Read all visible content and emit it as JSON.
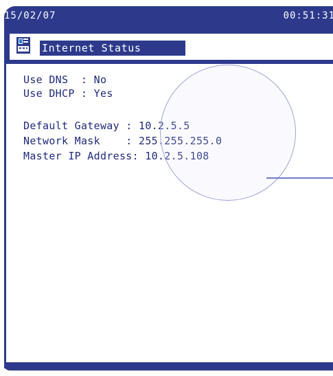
{
  "status_bar": {
    "date": "15/02/07",
    "time": "00:51:31"
  },
  "header": {
    "icon": "network-device-icon",
    "title": "Internet Status"
  },
  "settings": [
    {
      "label": "Use DNS  ",
      "separator": ":",
      "value": "No"
    },
    {
      "label": "Use DHCP ",
      "separator": ":",
      "value": "Yes"
    }
  ],
  "network": [
    {
      "label": "Default Gateway ",
      "separator": ":",
      "value": "10.2.5.5"
    },
    {
      "label": "Network Mask    ",
      "separator": ":",
      "value": "255.255.255.0"
    },
    {
      "label": "Master IP Address",
      "separator": ":",
      "value": "10.2.5.108"
    }
  ],
  "colors": {
    "frame": "#2d3a8c",
    "text": "#1f2a7a",
    "highlight": "#9aa2d8"
  }
}
